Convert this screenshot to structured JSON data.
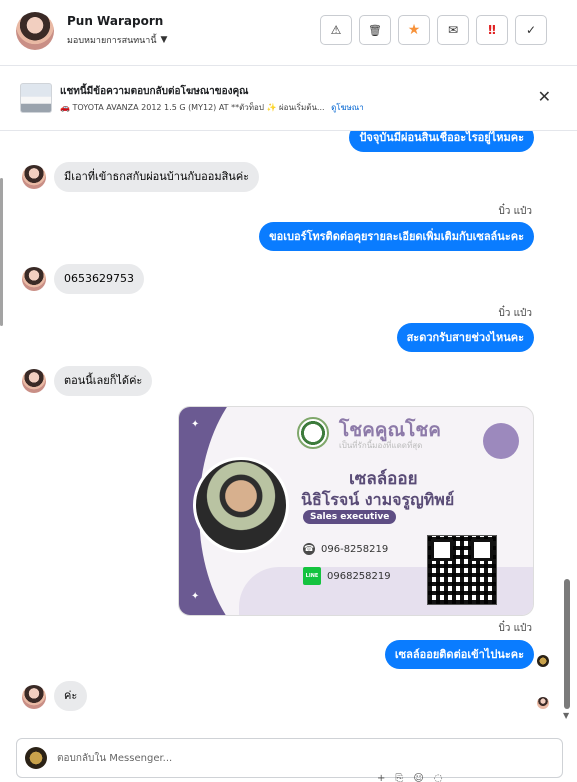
{
  "header": {
    "contact_name": "Pun Waraporn",
    "assign_label": "มอบหมายการสนทนานี้",
    "actions": [
      {
        "name": "report-spam-button",
        "glyph": "⚠"
      },
      {
        "name": "delete-button",
        "glyph": "🗑"
      },
      {
        "name": "star-button",
        "glyph": "★"
      },
      {
        "name": "mark-unread-button",
        "glyph": "✉"
      },
      {
        "name": "priority-button",
        "glyph": "‼"
      },
      {
        "name": "done-button",
        "glyph": "✓"
      }
    ],
    "accent_colors": {
      "star": "#f7923a",
      "priority": "#e02020"
    }
  },
  "ad_banner": {
    "title": "แชทนี้มีข้อความตอบกลับต่อโฆษณาของคุณ",
    "subtitle": "🚗 TOYOTA AVANZA 2012 1.5 G (MY12) AT **ตัวท็อป ✨ ผ่อนเริ่มต้น...",
    "link": "ดูโฆษณา",
    "close_glyph": "✕"
  },
  "messages": {
    "m0": "ปัจจุบันมีผ่อนสินเชื่ออะไรอยู่ไหมคะ",
    "m1": "มีเอาที่เข้าธกสกับผ่อนบ้านกับออมสินค่ะ",
    "s1": "บิ๋ว แป๋ว",
    "m2": "ขอเบอร์โทรติดต่อคุยรายละเอียดเพิ่มเติมกับเซลล์นะคะ",
    "m3": "0653629753",
    "s2": "บิ๋ว แป๋ว",
    "m4": "สะดวกรับสายช่วงไหนคะ",
    "m5": "ตอนนี้เลยก็ได้ค่ะ",
    "s3": "บิ๋ว แป๋ว",
    "m6": "เซลล์ออยติดต่อเข้าไปนะคะ",
    "m7": "ค่ะ"
  },
  "business_card": {
    "brand": "โชคคูณโชค",
    "tagline": "เป็นที่รักนี้มองที่แดดที่สุด",
    "role": "เซลล์ออย",
    "person": "นิธิโรจน์  งามจรูญทิพย์",
    "title": "Sales executive",
    "phone": "096-8258219",
    "line_label": "LINE",
    "line_id": "0968258219"
  },
  "composer": {
    "placeholder": "ตอบกลับใน Messenger..."
  },
  "colors": {
    "outgoing_bubble": "#0a7cff",
    "incoming_bubble": "#e9eaec",
    "card_purple": "#6b5a92"
  }
}
